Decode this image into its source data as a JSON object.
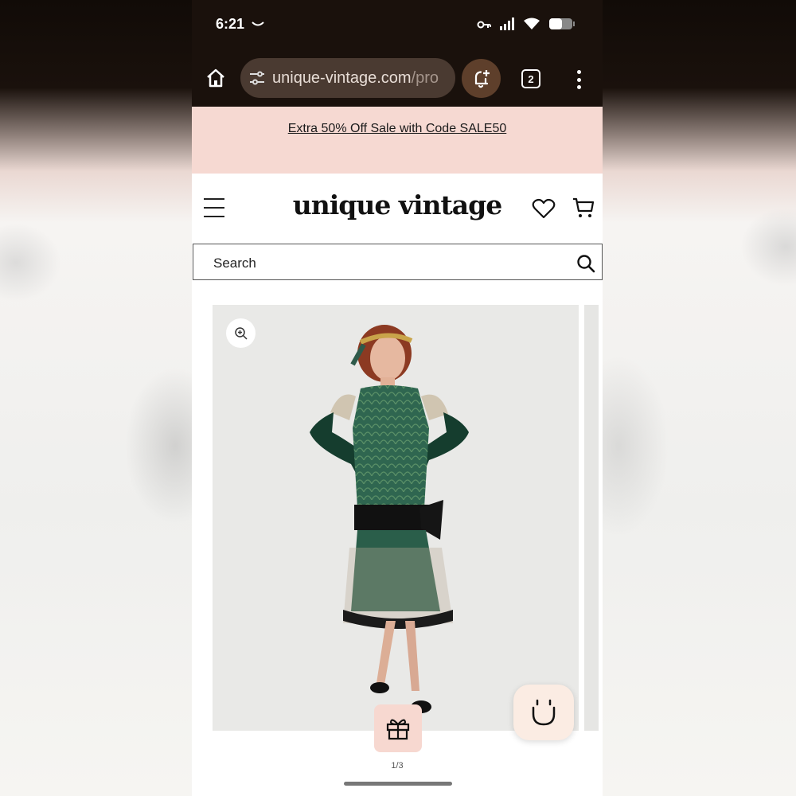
{
  "status_bar": {
    "time": "6:21",
    "icons": [
      "smile-icon",
      "key-icon",
      "signal-icon",
      "wifi-icon",
      "battery-icon"
    ]
  },
  "browser": {
    "url_host": "unique-vintage.com",
    "url_path": "/pro",
    "tab_count": "2",
    "icons": [
      "home-icon",
      "tune-icon",
      "bell-plus-icon",
      "tabs-icon",
      "more-vert-icon"
    ]
  },
  "promo": {
    "text": "Extra 50% Off Sale with Code SALE50"
  },
  "header": {
    "logo": "unique vintage",
    "icons": [
      "hamburger-icon",
      "heart-icon",
      "cart-icon"
    ]
  },
  "search": {
    "placeholder": "Search"
  },
  "gallery": {
    "page_indicator": "1/3",
    "current_page": 1,
    "total_pages": 3
  },
  "colors": {
    "browser_chrome": "#1a110c",
    "promo_bg": "#f6d9d2",
    "url_pill": "#4a3a31",
    "notif_btn": "#5e3f2b",
    "chat_bg": "#fbece3",
    "gift_bg": "#f7d8d0"
  }
}
